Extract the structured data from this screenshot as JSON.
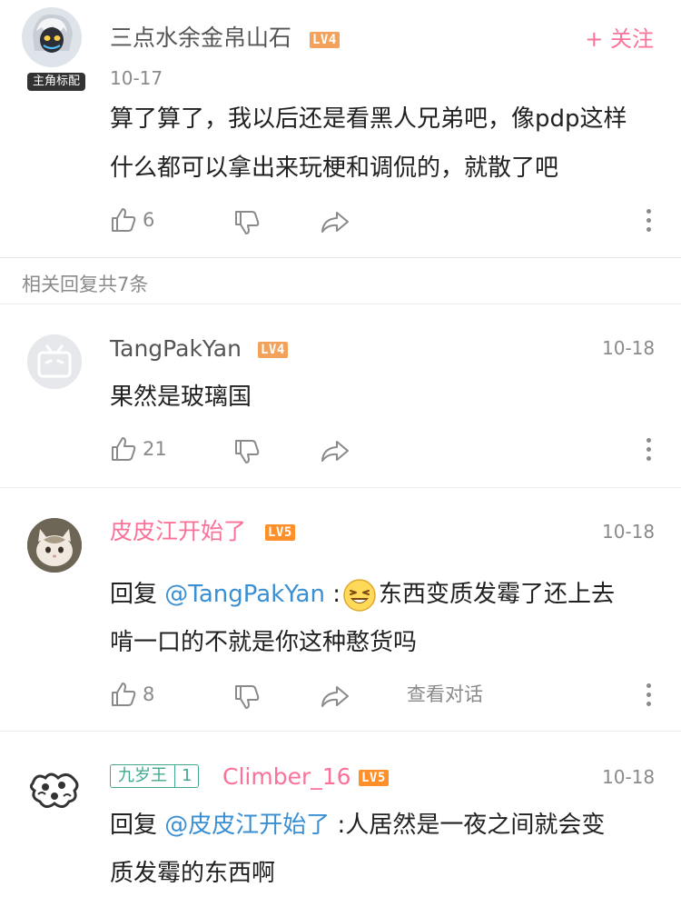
{
  "main_comment": {
    "username": "三点水余金帛山石",
    "level": "LV4",
    "badge": "主角标配",
    "follow": "+ 关注",
    "date": "10-17",
    "text_lines": [
      "算了算了，我以后还是看黑人兄弟吧，像pdp这样",
      "什么都可以拿出来玩梗和调侃的，就散了吧"
    ],
    "likes": "6"
  },
  "replies_header": "相关回复共7条",
  "replies": [
    {
      "username": "TangPakYan",
      "level": "LV4",
      "date": "10-18",
      "text": "果然是玻璃国",
      "likes": "21"
    },
    {
      "username": "皮皮江开始了",
      "level": "LV5",
      "date": "10-18",
      "reply_prefix": "回复 ",
      "mention": "@TangPakYan",
      "colon": " :",
      "text_line1": "东西变质发霉了还上去",
      "text_line2": "啃一口的不就是你这种憨货吗",
      "likes": "8",
      "view_conversation": "查看对话"
    },
    {
      "medal_name": "九岁王",
      "medal_level": "1",
      "username": "Climber_16",
      "level": "LV5",
      "date": "10-18",
      "reply_prefix": "回复 ",
      "mention": "@皮皮江开始了",
      "colon": " :",
      "text_line1": "人居然是一夜之间就会变",
      "text_line2": "质发霉的东西啊"
    }
  ],
  "colors": {
    "pink": "#fb7299",
    "level4": "#f2a25a",
    "level5": "#ff8f29",
    "mention": "#3a8fd3",
    "medal": "#43a88f"
  }
}
